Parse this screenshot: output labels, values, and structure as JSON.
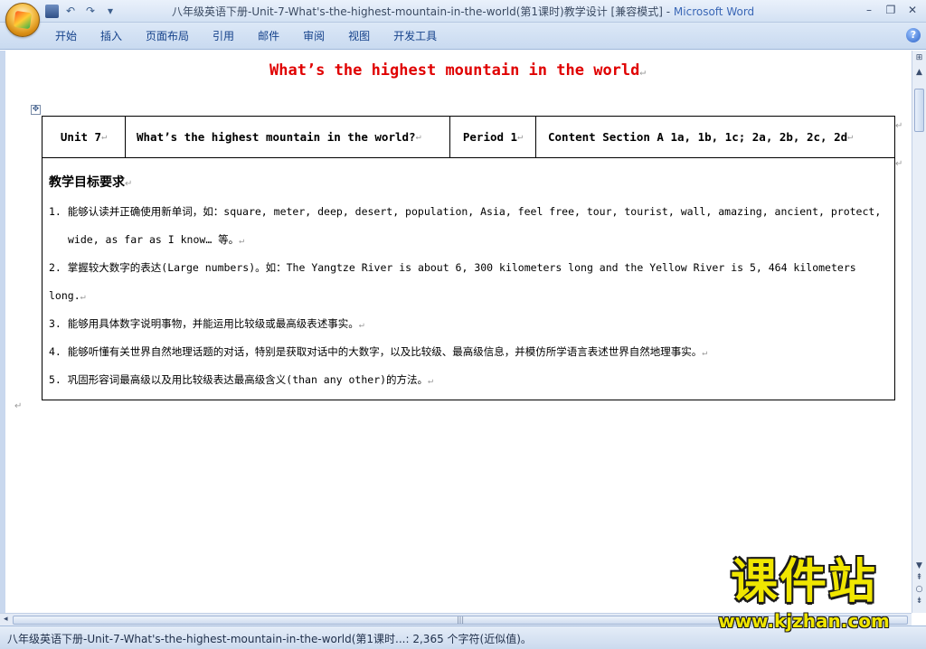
{
  "window": {
    "title": "八年级英语下册-Unit-7-What's-the-highest-mountain-in-the-world(第1课时)教学设计 [兼容模式]",
    "app_name": "Microsoft Word",
    "controls": {
      "minimize": "–",
      "restore": "❐",
      "close": "✕"
    }
  },
  "quick_access": {
    "undo": "↶",
    "redo": "↷",
    "customize": "▾"
  },
  "ribbon": {
    "tabs": [
      "开始",
      "插入",
      "页面布局",
      "引用",
      "邮件",
      "审阅",
      "视图",
      "开发工具"
    ],
    "help": "?"
  },
  "document": {
    "title": "What’s the highest mountain in the world",
    "table": {
      "header": {
        "unit": "Unit 7",
        "topic": "What’s the highest mountain in the world?",
        "period": "Period 1",
        "content": "Content  Section A  1a, 1b, 1c; 2a, 2b, 2c, 2d"
      },
      "objectives_heading": "教学目标要求",
      "objectives": [
        "1. 能够认读并正确使用新单词，如：square, meter, deep, desert, population, Asia, feel free, tour, tourist, wall, amazing, ancient, protect,",
        "wide, as far as I know… 等。",
        "2. 掌握较大数字的表达(Large numbers)。如：The Yangtze River is about 6, 300 kilometers long and the Yellow River is 5, 464 kilometers",
        "long.",
        "3. 能够用具体数字说明事物，并能运用比较级或最高级表述事实。",
        "4. 能够听懂有关世界自然地理话题的对话，特别是获取对话中的大数字，以及比较级、最高级信息，并模仿所学语言表述世界自然地理事实。",
        "5. 巩固形容词最高级以及用比较级表达最高级含义(than any other)的方法。"
      ]
    },
    "paragraph_mark": "↵"
  },
  "status_bar": {
    "text": "八年级英语下册-Unit-7-What's-the-highest-mountain-in-the-world(第1课时...: 2,365 个字符(近似值)。"
  },
  "watermark": {
    "name": "课件站",
    "url": "www.kjzhan.com"
  },
  "colors": {
    "title_red": "#e00000",
    "ribbon_text": "#15428b",
    "watermark_yellow": "#f0e600"
  }
}
